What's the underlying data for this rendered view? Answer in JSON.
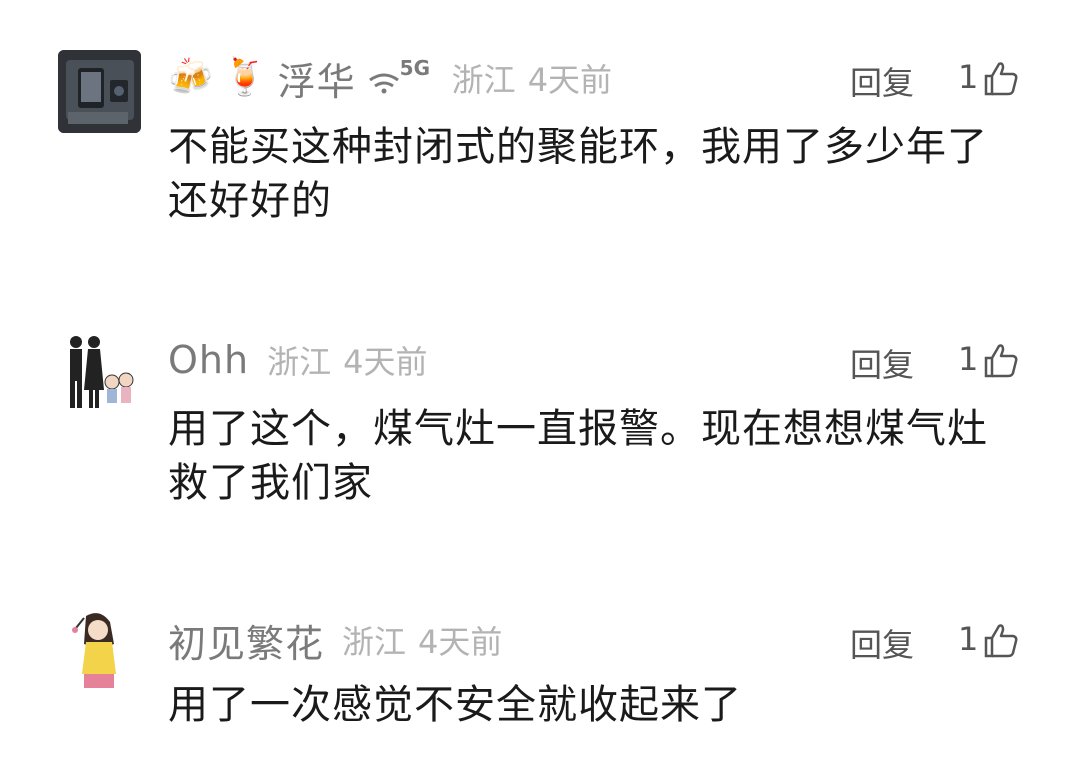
{
  "comments": [
    {
      "username": "浮华",
      "username_emojis": [
        "🍻",
        "🍹"
      ],
      "signal_badge": "5G",
      "region": "浙江",
      "time": "4天前",
      "reply_label": "回复",
      "likes": "1",
      "text": "不能买这种封闭式的聚能环，我用了多少年了还好好的",
      "avatar": "phone-photo-avatar"
    },
    {
      "username": "Ohh",
      "region": "浙江",
      "time": "4天前",
      "reply_label": "回复",
      "likes": "1",
      "text": "用了这个，煤气灶一直报警。现在想想煤气灶救了我们家",
      "avatar": "family-cartoon-avatar"
    },
    {
      "username": "初见繁花",
      "region": "浙江",
      "time": "4天前",
      "reply_label": "回复",
      "likes": "1",
      "text": "用了一次感觉不安全就收起来了",
      "avatar": "girl-cartoon-avatar"
    }
  ],
  "colors": {
    "username": "#7a7a7a",
    "meta": "#b3b3b3",
    "action": "#555555",
    "text": "#1a1a1a"
  }
}
